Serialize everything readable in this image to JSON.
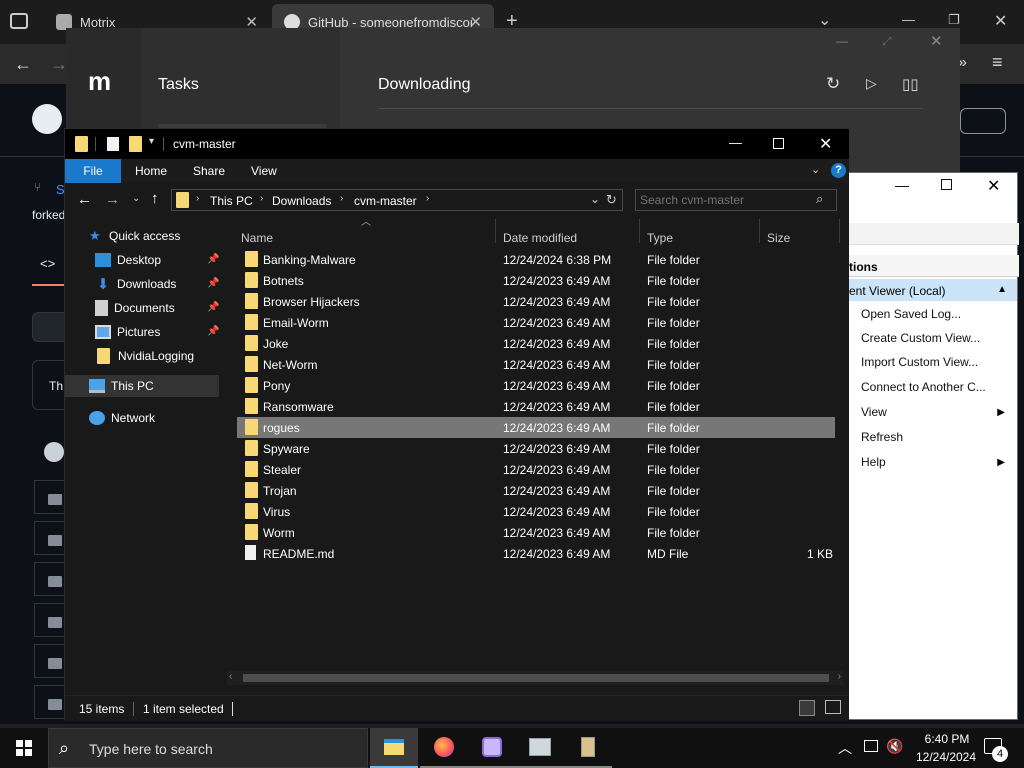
{
  "browser": {
    "tabs": [
      {
        "title": "Motrix",
        "close": "✕"
      },
      {
        "title": "GitHub - someonefromdiscord",
        "close": "✕"
      }
    ],
    "new_tab": "+",
    "window_controls": {
      "down": "⌄",
      "minimize": "—",
      "restore": "❐",
      "close": "✕"
    },
    "gh_fragments": {
      "fork_letter": "S",
      "forked_text": "forked",
      "code_icon": "<>",
      "th_text": "Th"
    }
  },
  "motrix": {
    "logo": "m",
    "section": "Tasks",
    "header": "Downloading"
  },
  "explorer": {
    "title": "cvm-master",
    "ribbon": {
      "file": "File",
      "home": "Home",
      "share": "Share",
      "view": "View",
      "help": "?"
    },
    "breadcrumb": [
      "This PC",
      "Downloads",
      "cvm-master"
    ],
    "search_placeholder": "Search cvm-master",
    "nav": {
      "quick_access": "Quick access",
      "desktop": "Desktop",
      "downloads": "Downloads",
      "documents": "Documents",
      "pictures": "Pictures",
      "nvidia": "NvidiaLogging",
      "this_pc": "This PC",
      "network": "Network"
    },
    "columns": {
      "name": "Name",
      "date": "Date modified",
      "type": "Type",
      "size": "Size"
    },
    "files": [
      {
        "name": "Banking-Malware",
        "date": "12/24/2024 6:38 PM",
        "type": "File folder",
        "size": ""
      },
      {
        "name": "Botnets",
        "date": "12/24/2023 6:49 AM",
        "type": "File folder",
        "size": ""
      },
      {
        "name": "Browser Hijackers",
        "date": "12/24/2023 6:49 AM",
        "type": "File folder",
        "size": ""
      },
      {
        "name": "Email-Worm",
        "date": "12/24/2023 6:49 AM",
        "type": "File folder",
        "size": ""
      },
      {
        "name": "Joke",
        "date": "12/24/2023 6:49 AM",
        "type": "File folder",
        "size": ""
      },
      {
        "name": "Net-Worm",
        "date": "12/24/2023 6:49 AM",
        "type": "File folder",
        "size": ""
      },
      {
        "name": "Pony",
        "date": "12/24/2023 6:49 AM",
        "type": "File folder",
        "size": ""
      },
      {
        "name": "Ransomware",
        "date": "12/24/2023 6:49 AM",
        "type": "File folder",
        "size": ""
      },
      {
        "name": "rogues",
        "date": "12/24/2023 6:49 AM",
        "type": "File folder",
        "size": ""
      },
      {
        "name": "Spyware",
        "date": "12/24/2023 6:49 AM",
        "type": "File folder",
        "size": ""
      },
      {
        "name": "Stealer",
        "date": "12/24/2023 6:49 AM",
        "type": "File folder",
        "size": ""
      },
      {
        "name": "Trojan",
        "date": "12/24/2023 6:49 AM",
        "type": "File folder",
        "size": ""
      },
      {
        "name": "Virus",
        "date": "12/24/2023 6:49 AM",
        "type": "File folder",
        "size": ""
      },
      {
        "name": "Worm",
        "date": "12/24/2023 6:49 AM",
        "type": "File folder",
        "size": ""
      },
      {
        "name": "README.md",
        "date": "12/24/2023 6:49 AM",
        "type": "MD File",
        "size": "1 KB"
      }
    ],
    "status": {
      "items": "15 items",
      "selected": "1 item selected"
    }
  },
  "eventviewer": {
    "header": "tions",
    "selected": "ent Viewer (Local)",
    "items": [
      "Open Saved Log...",
      "Create Custom View...",
      "Import Custom View...",
      "Connect to Another C...",
      "View",
      "Refresh",
      "Help"
    ]
  },
  "taskbar": {
    "search_placeholder": "Type here to search",
    "time": "6:40 PM",
    "date": "12/24/2024",
    "notifications": "4"
  },
  "colors": {
    "folder": "#f8d775",
    "selection": "#777777",
    "accent": "#0078d7"
  }
}
